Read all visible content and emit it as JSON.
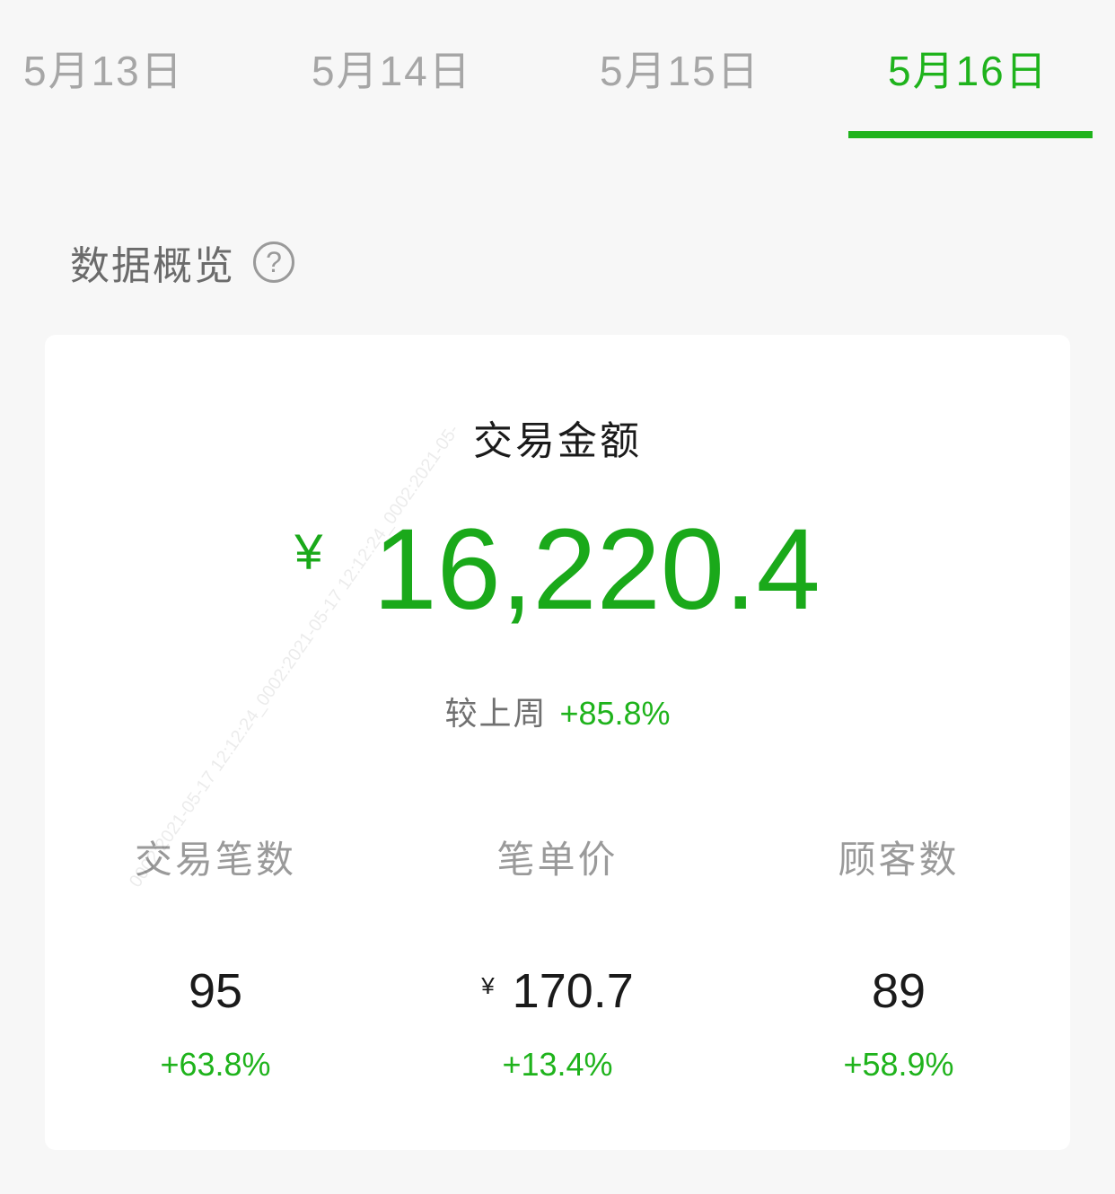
{
  "tabs": [
    {
      "label": "5月13日",
      "active": false
    },
    {
      "label": "5月14日",
      "active": false
    },
    {
      "label": "5月15日",
      "active": false
    },
    {
      "label": "5月16日",
      "active": true
    }
  ],
  "section": {
    "title": "数据概览",
    "help_icon": "question-circle-icon"
  },
  "summary": {
    "title": "交易金额",
    "currency": "¥",
    "amount": "16,220.4",
    "compare_label": "较上周",
    "compare_value": "+85.8%"
  },
  "metrics": [
    {
      "label": "交易笔数",
      "currency": "",
      "value": "95",
      "change": "+63.8%"
    },
    {
      "label": "笔单价",
      "currency": "¥",
      "value": "170.7",
      "change": "+13.4%"
    },
    {
      "label": "顾客数",
      "currency": "",
      "value": "89",
      "change": "+58.9%"
    }
  ],
  "watermark": "0002:2021-05-17 12:12:24_0002:2021-05-17 12:12:24_0002:2021-05-",
  "colors": {
    "accent": "#1fb31c",
    "amount": "#1aa91a",
    "background": "#f7f7f7",
    "card": "#ffffff"
  }
}
